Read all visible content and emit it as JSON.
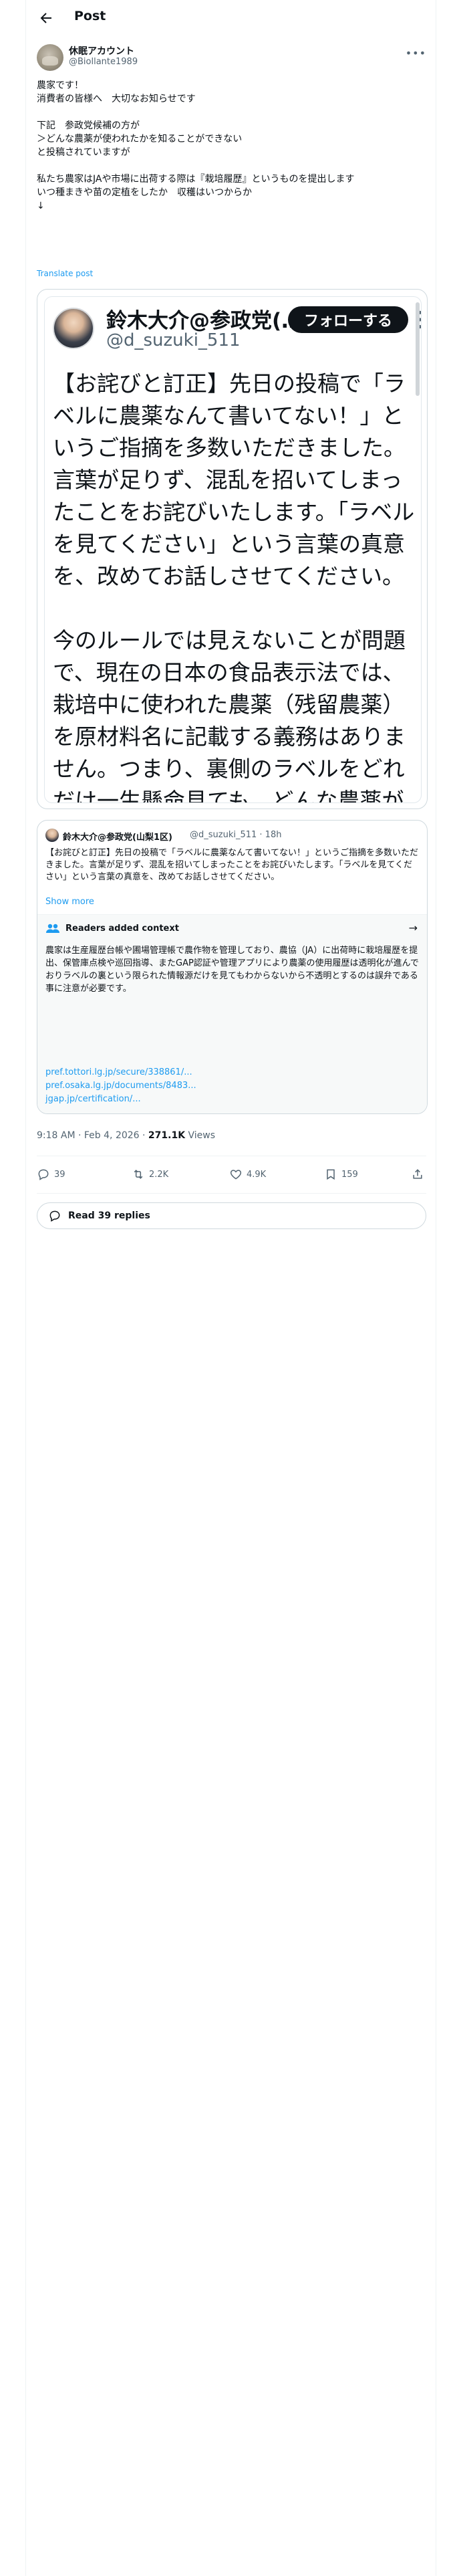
{
  "header": {
    "title": "Post",
    "back_icon": "arrow-left-icon"
  },
  "author": {
    "name": "休眠アカウント",
    "handle": "@Biollante1989"
  },
  "post": {
    "text": "農家です！\n消費者の皆様へ　大切なお知らせです\n\n下記　参政党候補の方が\n＞どんな農薬が使われたかを知ることができない\nと投稿されていますが\n\n私たち農家はJAや市場に出荷する際は『栽培履歴』というものを提出します\nいつ種まきや苗の定植をしたか　収穫はいつからか\n↓",
    "translate_label": "Translate post"
  },
  "embedded_image": {
    "name": "鈴木大介@参政党(…",
    "handle": "@d_suzuki_511",
    "follow_label": "フォローする",
    "text": "【お詫びと訂正】先日の投稿で「ラベルに農薬なんて書いてない！」というご指摘を多数いただきました。言葉が足りず、混乱を招いてしまったことをお詫びいたします。「ラベルを見てください」という言葉の真意を、改めてお話しさせてください。\n\n今のルールでは見えないことが問題で、現在の日本の食品表示法では、栽培中に使われた農薬（残留農薬）を原材料名に記載する義務はありません。つまり、裏側のラベルをどれだけ一生懸命見ても、どんな農薬が使われたかを私たちは知ることができないのが現状です。ラベルに"
  },
  "quoted": {
    "name": "鈴木大介@参政党(山梨1区)",
    "handle": "@d_suzuki_511 · 18h",
    "text": "【お詫びと訂正】先日の投稿で「ラベルに農薬なんて書いてない！」というご指摘を多数いただきました。言葉が足りず、混乱を招いてしまったことをお詫びいたします。「ラベルを見てください」という言葉の真意を、改めてお話しさせてください。",
    "show_more": "Show more",
    "notes": {
      "title": "Readers added context",
      "text": "農家は生産履歴台帳や圃場管理帳で農作物を管理しており、農協（JA）に出荷時に栽培履歴を提出、保管庫点検や巡回指導、またGAP認証や管理アプリにより農薬の使用履歴は透明化が進んでおりラベルの裏という限られた情報源だけを見てもわからないから不透明とするのは誤弁である事に注意が必要です。",
      "links": [
        "pref.tottori.lg.jp/secure/338861/...",
        "pref.osaka.lg.jp/documents/8483...",
        "jgap.jp/certification/..."
      ]
    }
  },
  "meta": {
    "time": "9:18 AM · Feb 4, 2026 · ",
    "views_count": "271.1K",
    "views_label": " Views"
  },
  "actions": {
    "replies": "39",
    "reposts": "2.2K",
    "likes": "4.9K",
    "bookmarks": "159"
  },
  "read_replies_label": "Read 39 replies"
}
